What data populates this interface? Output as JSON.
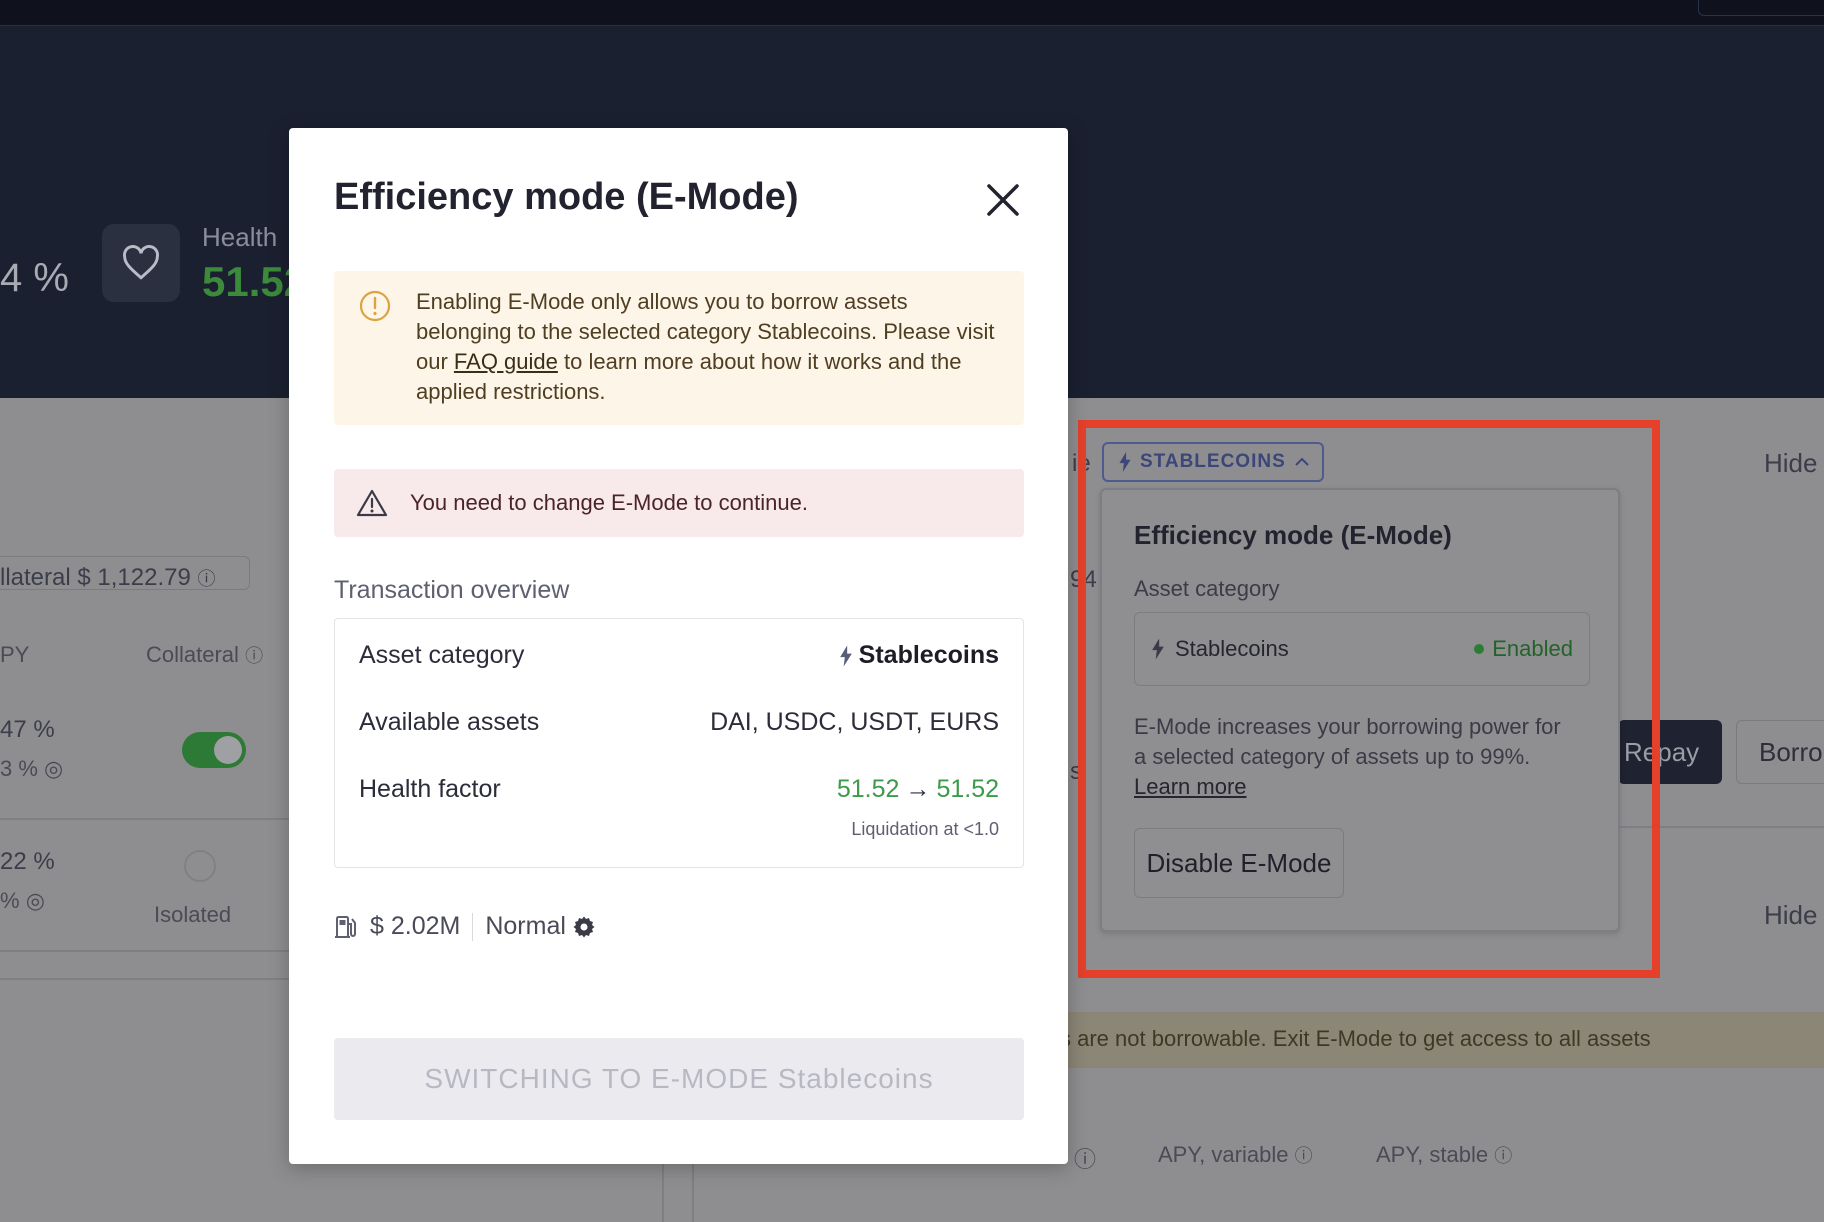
{
  "background": {
    "percent_fragment": "4 %",
    "health_label": "Health",
    "health_value": "51.52",
    "collateral_label": "llateral",
    "collateral_value": "$ 1,122.79",
    "col_apy": "PY",
    "col_collateral": "Collateral",
    "row1_apy": "47 %",
    "row1_sub": "3 %",
    "row2_apy": "22 %",
    "row2_sub": "%",
    "isolated_label": "Isolated",
    "hide_top": "Hide",
    "hide_bottom": "Hide",
    "mid_fragment_1": "ie",
    "mid_fragment_2": "94",
    "mid_fragment_3": "s",
    "repay_button": "Repay",
    "borrow_button": "Borro",
    "not_borrowable_text": "s are not borrowable. Exit E-Mode to get access to all assets",
    "apy_variable": "APY, variable",
    "apy_stable": "APY, stable"
  },
  "emode_popover": {
    "chip_label": "STABLECOINS",
    "title": "Efficiency mode (E-Mode)",
    "asset_category_label": "Asset category",
    "category_value": "Stablecoins",
    "status": "Enabled",
    "description": "E-Mode increases your borrowing power for a selected category of assets up to 99%.",
    "learn_more": "Learn more",
    "disable_button": "Disable E-Mode"
  },
  "modal": {
    "title": "Efficiency mode (E-Mode)",
    "info_text_before": "Enabling E-Mode only allows you to borrow assets belonging to the selected category Stablecoins. Please visit our",
    "info_link": "FAQ guide",
    "info_text_after": "to learn more about how it works and the applied restrictions.",
    "warning_text": "You need to change E-Mode to continue.",
    "overview_label": "Transaction overview",
    "rows": {
      "asset_category_label": "Asset category",
      "asset_category_value": "Stablecoins",
      "available_assets_label": "Available assets",
      "available_assets_value": "DAI, USDC, USDT, EURS",
      "health_factor_label": "Health factor",
      "health_from": "51.52",
      "health_arrow": "→",
      "health_to": "51.52",
      "liquidation_note": "Liquidation at <1.0"
    },
    "gas_value": "$ 2.02M",
    "gas_speed": "Normal",
    "submit_button": "SWITCHING TO E-MODE Stablecoins"
  },
  "colors": {
    "highlight": "#e5402a",
    "health_green": "#3c9a4a",
    "info_bg": "#fdf5e8",
    "warning_bg": "#f8e9ea"
  }
}
